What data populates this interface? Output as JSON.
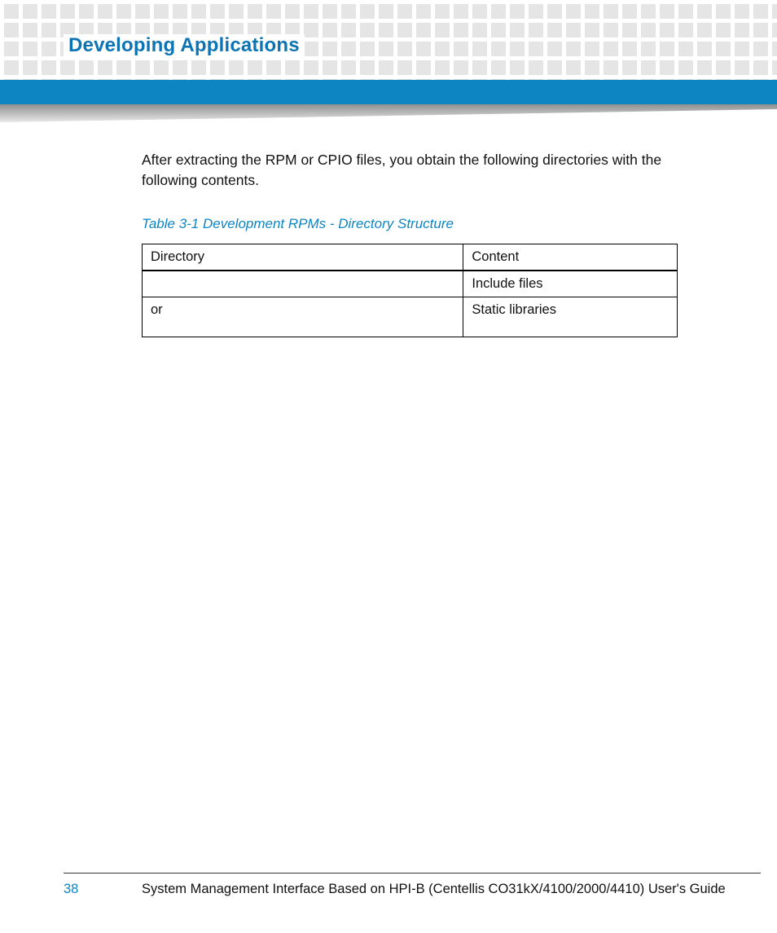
{
  "header": {
    "title": "Developing Applications"
  },
  "body": {
    "intro": "After extracting the RPM or CPIO files, you obtain the following directories with the following contents."
  },
  "table": {
    "caption": "Table 3-1 Development RPMs - Directory Structure",
    "columns": [
      "Directory",
      "Content"
    ],
    "rows": [
      {
        "directory": "",
        "content": "Include files"
      },
      {
        "directory": "or",
        "content": "Static libraries"
      }
    ]
  },
  "footer": {
    "page": "38",
    "text": "System Management Interface Based on HPI-B (Centellis CO31kX/4100/2000/4410) User's Guide"
  }
}
